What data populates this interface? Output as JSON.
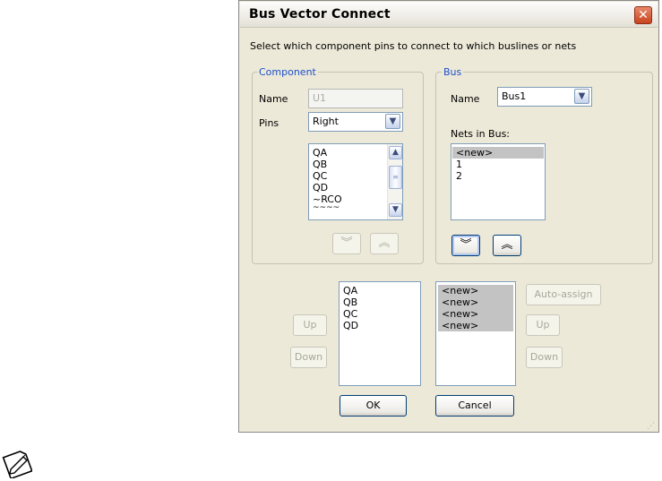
{
  "dialog": {
    "title": "Bus Vector Connect",
    "close_glyph": "✕",
    "instruction": "Select which component pins to connect to which buslines or nets"
  },
  "component": {
    "legend": "Component",
    "name_label": "Name",
    "name_value": "U1",
    "pins_label": "Pins",
    "pins_value": "Right",
    "pin_items": [
      "QA",
      "QB",
      "QC",
      "QD",
      "~RCO",
      "~~~~"
    ]
  },
  "bus": {
    "legend": "Bus",
    "name_label": "Name",
    "name_value": "Bus1",
    "nets_label": "Nets in Bus:",
    "net_items": [
      "<new>",
      "1",
      "2"
    ]
  },
  "mapping": {
    "left_items": [
      "QA",
      "QB",
      "QC",
      "QD"
    ],
    "right_items": [
      "<new>",
      "<new>",
      "<new>",
      "<new>"
    ]
  },
  "buttons": {
    "up": "Up",
    "down": "Down",
    "auto_assign": "Auto-assign",
    "ok": "OK",
    "cancel": "Cancel",
    "move_down_glyph": "︾",
    "move_up_glyph": "︽",
    "dropdown_glyph": "▼",
    "scroll_up_glyph": "▲",
    "scroll_down_glyph": "▼"
  },
  "icons": {
    "note_icon": "note-pencil",
    "accent": "#1e4fcc",
    "close_color": "#c7431e"
  }
}
